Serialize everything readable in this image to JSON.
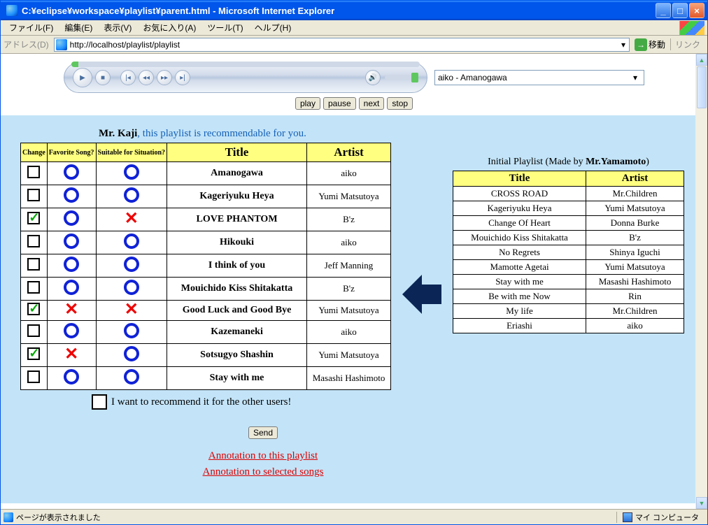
{
  "window": {
    "title": "C:¥eclipse¥workspace¥playlist¥parent.html - Microsoft Internet Explorer"
  },
  "menu": {
    "file": "ファイル(F)",
    "edit": "編集(E)",
    "view": "表示(V)",
    "favorites": "お気に入り(A)",
    "tools": "ツール(T)",
    "help": "ヘルプ(H)"
  },
  "address": {
    "label": "アドレス(D)",
    "url": "http://localhost/playlist/playlist",
    "go": "移動",
    "links": "リンク"
  },
  "player": {
    "now_playing": "aiko - Amanogawa",
    "play": "play",
    "pause": "pause",
    "next": "next",
    "stop": "stop"
  },
  "recommend": {
    "user": "Mr. Kaji",
    "text": ", this playlist is recommendable for you."
  },
  "left_table": {
    "headers": {
      "change": "Change",
      "fav": "Favorite Song?",
      "suit": "Suitable for Situation?",
      "title": "Title",
      "artist": "Artist"
    },
    "rows": [
      {
        "change": false,
        "fav": "o",
        "suit": "o",
        "title": "Amanogawa",
        "artist": "aiko"
      },
      {
        "change": false,
        "fav": "o",
        "suit": "o",
        "title": "Kageriyuku Heya",
        "artist": "Yumi Matsutoya"
      },
      {
        "change": true,
        "fav": "o",
        "suit": "x",
        "title": "LOVE PHANTOM",
        "artist": "B'z"
      },
      {
        "change": false,
        "fav": "o",
        "suit": "o",
        "title": "Hikouki",
        "artist": "aiko"
      },
      {
        "change": false,
        "fav": "o",
        "suit": "o",
        "title": "I think of you",
        "artist": "Jeff Manning"
      },
      {
        "change": false,
        "fav": "o",
        "suit": "o",
        "title": "Mouichido Kiss Shitakatta",
        "artist": "B'z"
      },
      {
        "change": true,
        "fav": "x",
        "suit": "x",
        "title": "Good Luck and Good Bye",
        "artist": "Yumi Matsutoya"
      },
      {
        "change": false,
        "fav": "o",
        "suit": "o",
        "title": "Kazemaneki",
        "artist": "aiko"
      },
      {
        "change": true,
        "fav": "x",
        "suit": "o",
        "title": "Sotsugyo Shashin",
        "artist": "Yumi Matsutoya"
      },
      {
        "change": false,
        "fav": "o",
        "suit": "o",
        "title": "Stay with me",
        "artist": "Masashi Hashimoto"
      }
    ]
  },
  "right_table": {
    "caption_pre": "Initial Playlist (Made by ",
    "caption_name": "Mr.Yamamoto",
    "caption_post": ")",
    "headers": {
      "title": "Title",
      "artist": "Artist"
    },
    "rows": [
      {
        "title": "CROSS ROAD",
        "artist": "Mr.Children"
      },
      {
        "title": "Kageriyuku Heya",
        "artist": "Yumi Matsutoya"
      },
      {
        "title": "Change Of Heart",
        "artist": "Donna Burke"
      },
      {
        "title": "Mouichido Kiss Shitakatta",
        "artist": "B'z"
      },
      {
        "title": "No Regrets",
        "artist": "Shinya Iguchi"
      },
      {
        "title": "Mamotte Agetai",
        "artist": "Yumi Matsutoya"
      },
      {
        "title": "Stay with me",
        "artist": "Masashi Hashimoto"
      },
      {
        "title": "Be with me Now",
        "artist": "Rin"
      },
      {
        "title": "My life",
        "artist": "Mr.Children"
      },
      {
        "title": "Eriashi",
        "artist": "aiko"
      }
    ]
  },
  "under": {
    "recommend_others": "I want to recommend it for the other users!",
    "send": "Send",
    "anno_playlist": "Annotation to this playlist",
    "anno_songs": "Annotation to selected songs"
  },
  "status": {
    "left": "ページが表示されました",
    "right": "マイ コンピュータ"
  }
}
